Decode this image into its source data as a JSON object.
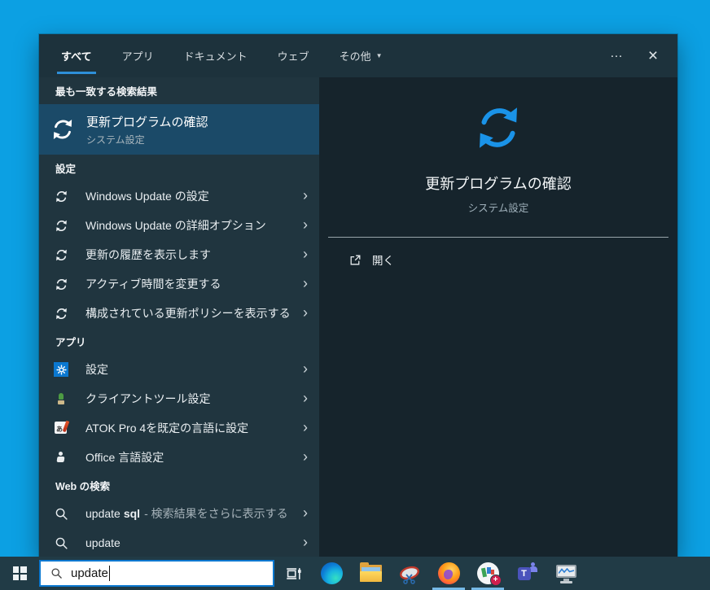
{
  "colors": {
    "desktop_blue": "#0ca0e3",
    "panel_dark": "#20353f",
    "panel_darker": "#16242c",
    "header_bar": "#1d323c",
    "highlight_row": "#1b4a68",
    "accent_blue": "#0b78d0",
    "tab_underline": "#2e8fd9",
    "preview_icon_blue": "#1a93e8",
    "taskbar": "#213b46"
  },
  "glyphs": {
    "more": "…",
    "close": "×",
    "chevron": "›",
    "dropdown": "▼",
    "plus_badge": "+"
  },
  "tabs": [
    {
      "label": "すべて",
      "active": true
    },
    {
      "label": "アプリ",
      "active": false
    },
    {
      "label": "ドキュメント",
      "active": false
    },
    {
      "label": "ウェブ",
      "active": false
    },
    {
      "label": "その他",
      "active": false,
      "has_dropdown": true
    }
  ],
  "best_match": {
    "section_header": "最も一致する検索結果",
    "title": "更新プログラムの確認",
    "subtitle": "システム設定",
    "icon": "refresh-icon"
  },
  "settings_section": {
    "header": "設定",
    "items": [
      {
        "label": "Windows Update の設定",
        "icon": "refresh-icon"
      },
      {
        "label": "Windows Update の詳細オプション",
        "icon": "refresh-icon"
      },
      {
        "label": "更新の履歴を表示します",
        "icon": "refresh-icon"
      },
      {
        "label": "アクティブ時間を変更する",
        "icon": "refresh-icon"
      },
      {
        "label": "構成されている更新ポリシーを表示する",
        "icon": "refresh-icon"
      }
    ]
  },
  "apps_section": {
    "header": "アプリ",
    "items": [
      {
        "label": "設定",
        "icon": "settings-gear-icon"
      },
      {
        "label": "クライアントツール設定",
        "icon": "client-tools-icon"
      },
      {
        "label": "ATOK Pro 4を既定の言語に設定",
        "icon": "atok-icon"
      },
      {
        "label": "Office 言語設定",
        "icon": "office-language-icon"
      }
    ]
  },
  "web_section": {
    "header": "Web の検索",
    "items": [
      {
        "typed": "update",
        "completion": "sql",
        "suffix": "- 検索結果をさらに表示する",
        "icon": "search-icon"
      },
      {
        "typed": "update",
        "completion": "",
        "suffix": "",
        "icon": "search-icon"
      }
    ]
  },
  "preview": {
    "icon": "refresh-icon",
    "title": "更新プログラムの確認",
    "subtitle": "システム設定",
    "open_label": "開く",
    "open_icon": "open-external-icon"
  },
  "taskbar": {
    "start": "windows-start-icon",
    "search": {
      "value": "update",
      "icon": "search-icon"
    },
    "task_view": "task-view-icon",
    "apps": [
      {
        "icon": "microsoft-edge-icon",
        "running": false
      },
      {
        "icon": "file-explorer-icon",
        "running": false
      },
      {
        "icon": "snipping-tool-icon",
        "running": false
      },
      {
        "icon": "firefox-icon",
        "running": true
      },
      {
        "icon": "notes-app-icon",
        "running": true,
        "badge": "+"
      },
      {
        "icon": "microsoft-teams-icon",
        "running": false
      },
      {
        "icon": "system-monitor-icon",
        "running": false
      }
    ]
  }
}
